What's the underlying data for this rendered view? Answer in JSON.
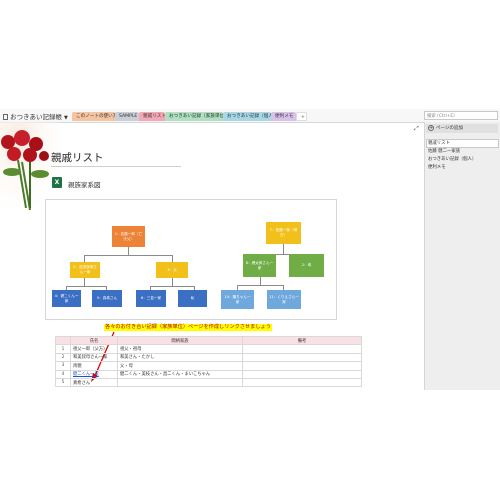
{
  "app": {
    "notebook_title": "おつきあい記録帳",
    "search_placeholder": "検索 (Ctrl+E)",
    "tabs": [
      {
        "label": "このノートの使い方",
        "color": "#f5c4a1"
      },
      {
        "label": "SAMPLE",
        "color": "#c9cfd6"
      },
      {
        "label": "親戚リスト",
        "color": "#f4a7b4"
      },
      {
        "label": "おつきあい記録（家族単位）",
        "color": "#aee0c1"
      },
      {
        "label": "おつきあい記録（個人）",
        "color": "#a8d8e6"
      },
      {
        "label": "便利メモ",
        "color": "#d9c2ea"
      },
      {
        "label": "+",
        "color": "#ffffff"
      }
    ]
  },
  "page_pane": {
    "add_page_label": "ページの追加",
    "pages": [
      "親戚リスト",
      "佐藤 健二一家族",
      "おつきあい記録（個人）",
      "便利メモ"
    ]
  },
  "page": {
    "title": "親戚リスト",
    "attachment_label": "親族家系図"
  },
  "diagram": {
    "nodes": [
      {
        "id": "n1",
        "label": "1：佐藤一郎（亡き父）",
        "color": "#ec8337"
      },
      {
        "id": "n2",
        "label": "2：吉田良明さん一家",
        "color": "#f2c01b"
      },
      {
        "id": "n3",
        "label": "3：父",
        "color": "#f2c01b"
      },
      {
        "id": "n4",
        "label": "4：健二くん一家",
        "color": "#3a6fc4"
      },
      {
        "id": "n5",
        "label": "5：真希さん",
        "color": "#3a6fc4"
      },
      {
        "id": "n6",
        "label": "6：三並一家",
        "color": "#3a6fc4"
      },
      {
        "id": "n7",
        "label": "私",
        "color": "#3a6fc4"
      },
      {
        "id": "n8",
        "label": "7：佐藤一家（母方）",
        "color": "#f2c01b"
      },
      {
        "id": "n9",
        "label": "8：健太郎さん一家",
        "color": "#70ad47"
      },
      {
        "id": "n10",
        "label": "2：母",
        "color": "#70ad47"
      },
      {
        "id": "n11",
        "label": "10：隆ちゃん一家",
        "color": "#6fa8dc"
      },
      {
        "id": "n12",
        "label": "11：くりえさん一家",
        "color": "#6fa8dc"
      }
    ]
  },
  "callout": "各々のお付き合い記録（家族単位）ページを作成しリンクさせましょう",
  "table": {
    "headers": [
      "",
      "氏名",
      "間柄家族",
      "備考"
    ],
    "rows": [
      {
        "no": "1",
        "name": "祖父一郎（父方）",
        "relation": "祖父・祖母",
        "note": ""
      },
      {
        "no": "2",
        "name": "和美叔母さん一家",
        "relation": "和美さん・たかし",
        "note": ""
      },
      {
        "no": "3",
        "name": "両親",
        "relation": "父・母",
        "note": ""
      },
      {
        "no": "4",
        "name": "健二くん一家",
        "relation": "健二くん・美枝さん・昌二くん・まいこちゃん",
        "note": "",
        "link": true
      },
      {
        "no": "5",
        "name": "真希さん",
        "relation": "",
        "note": ""
      }
    ]
  },
  "colors": {
    "accent_red": "#c00000",
    "highlight": "#ffff00",
    "header_pink": "#f9e0e5"
  }
}
